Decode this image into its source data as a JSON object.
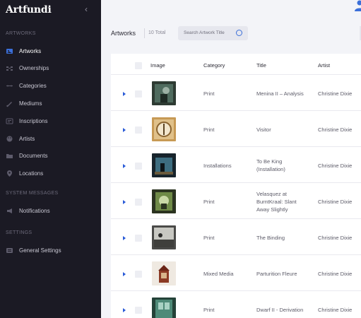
{
  "app": {
    "logo": "Artfundi"
  },
  "sidebar": {
    "sections": [
      {
        "label": "ARTWORKS",
        "items": [
          {
            "label": "Artworks",
            "icon": "image-icon",
            "active": true
          },
          {
            "label": "Ownerships",
            "icon": "ownership-icon"
          },
          {
            "label": "Categories",
            "icon": "categories-icon"
          },
          {
            "label": "Mediums",
            "icon": "brush-icon"
          },
          {
            "label": "Inscriptions",
            "icon": "inscription-icon"
          },
          {
            "label": "Artists",
            "icon": "palette-icon"
          },
          {
            "label": "Documents",
            "icon": "folder-icon"
          },
          {
            "label": "Locations",
            "icon": "location-pin-icon"
          }
        ]
      },
      {
        "label": "SYSTEM MESSAGES",
        "items": [
          {
            "label": "Notifications",
            "icon": "megaphone-icon"
          }
        ]
      },
      {
        "label": "SETTINGS",
        "items": [
          {
            "label": "General Settings",
            "icon": "settings-icon"
          }
        ]
      }
    ]
  },
  "header": {
    "title": "Artworks",
    "count": "10 Total",
    "search_placeholder": "Search Artwork Title"
  },
  "table": {
    "columns": [
      "Image",
      "Category",
      "Title",
      "Artist"
    ],
    "rows": [
      {
        "category": "Print",
        "title": [
          "Menina II – Analysis"
        ],
        "artist": "Christine Dixie",
        "thumb": "teal-figure"
      },
      {
        "category": "Print",
        "title": [
          "Visitor"
        ],
        "artist": "Christine Dixie",
        "thumb": "gold-frame"
      },
      {
        "category": "Installations",
        "title": [
          "To Be King",
          "(Installation)"
        ],
        "artist": "Christine Dixie",
        "thumb": "dark-room"
      },
      {
        "category": "Print",
        "title": [
          "Velasquez at",
          "BurntKraal: Slant",
          "Away Slightly"
        ],
        "artist": "Christine Dixie",
        "thumb": "olive-mirror"
      },
      {
        "category": "Print",
        "title": [
          "The Binding"
        ],
        "artist": "Christine Dixie",
        "thumb": "grey-scene"
      },
      {
        "category": "Mixed Media",
        "title": [
          "Parturition Fleure"
        ],
        "artist": "Christine Dixie",
        "thumb": "house"
      },
      {
        "category": "Print",
        "title": [
          "Dwarf II - Derivation"
        ],
        "artist": "Christine Dixie",
        "thumb": "teal-window"
      }
    ]
  },
  "colors": {
    "sidebar_bg": "#1b1a24",
    "accent": "#2a5bd7",
    "page_bg": "#f3f4f8"
  }
}
